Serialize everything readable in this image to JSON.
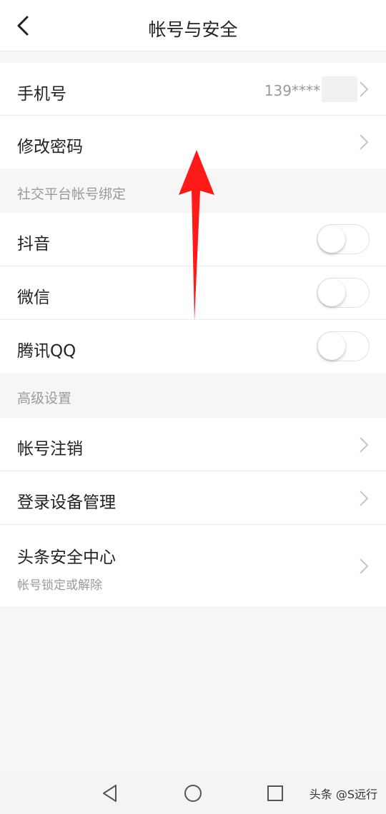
{
  "header": {
    "title": "帐号与安全",
    "back_icon": "chevron-left-icon"
  },
  "account": {
    "phone_label": "手机号",
    "phone_value": "139****",
    "password_label": "修改密码"
  },
  "social": {
    "section_title": "社交平台帐号绑定",
    "items": [
      {
        "label": "抖音",
        "enabled": false
      },
      {
        "label": "微信",
        "enabled": false
      },
      {
        "label": "腾讯QQ",
        "enabled": false
      }
    ]
  },
  "advanced": {
    "section_title": "高级设置",
    "cancel_label": "帐号注销",
    "devices_label": "登录设备管理",
    "security_label": "头条安全中心",
    "security_sub": "帐号锁定或解除"
  },
  "navbar": {
    "icons": [
      "nav-back-icon",
      "nav-home-icon",
      "nav-recents-icon"
    ],
    "watermark": "头条 @S远行"
  },
  "colors": {
    "annotation_arrow": "#ff1a1a",
    "toggle_off": "#ffffff"
  }
}
